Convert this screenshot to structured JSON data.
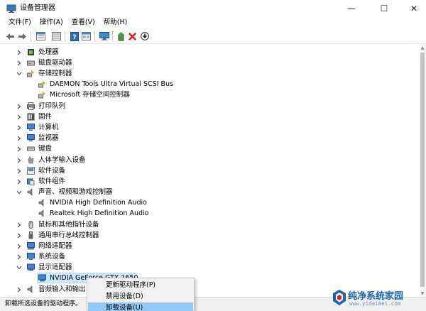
{
  "window": {
    "title": "设备管理器",
    "minimize": "—",
    "maximize": "☐",
    "close": "✕"
  },
  "menu": [
    "文件(F)",
    "操作(A)",
    "查看(V)",
    "帮助(H)"
  ],
  "toolbar_icons": [
    "back-icon",
    "forward-icon",
    "properties-icon",
    "device-list-icon",
    "help-icon",
    "grid-icon",
    "monitor-icon",
    "update-driver-icon",
    "uninstall-icon",
    "download-icon"
  ],
  "tree": [
    {
      "label": "处理器",
      "level": 0,
      "expanded": false,
      "icon": "cpu-icon"
    },
    {
      "label": "磁盘驱动器",
      "level": 0,
      "expanded": false,
      "icon": "disk-icon"
    },
    {
      "label": "存储控制器",
      "level": 0,
      "expanded": true,
      "icon": "storage-controller-icon"
    },
    {
      "label": "DAEMON Tools Ultra Virtual SCSI Bus",
      "level": 1,
      "icon": "storage-controller-icon"
    },
    {
      "label": "Microsoft 存储空间控制器",
      "level": 1,
      "icon": "storage-controller-icon"
    },
    {
      "label": "打印队列",
      "level": 0,
      "expanded": false,
      "icon": "printer-icon"
    },
    {
      "label": "固件",
      "level": 0,
      "expanded": false,
      "icon": "firmware-icon"
    },
    {
      "label": "计算机",
      "level": 0,
      "expanded": false,
      "icon": "computer-icon"
    },
    {
      "label": "监视器",
      "level": 0,
      "expanded": false,
      "icon": "monitor-icon"
    },
    {
      "label": "键盘",
      "level": 0,
      "expanded": false,
      "icon": "keyboard-icon"
    },
    {
      "label": "人体学输入设备",
      "level": 0,
      "expanded": false,
      "icon": "hid-icon"
    },
    {
      "label": "软件设备",
      "level": 0,
      "expanded": false,
      "icon": "software-device-icon"
    },
    {
      "label": "软件组件",
      "level": 0,
      "expanded": false,
      "icon": "software-component-icon"
    },
    {
      "label": "声音、视频和游戏控制器",
      "level": 0,
      "expanded": true,
      "icon": "speaker-icon"
    },
    {
      "label": "NVIDIA High Definition Audio",
      "level": 1,
      "icon": "speaker-icon"
    },
    {
      "label": "Realtek High Definition Audio",
      "level": 1,
      "icon": "speaker-icon"
    },
    {
      "label": "鼠标和其他指针设备",
      "level": 0,
      "expanded": false,
      "icon": "mouse-icon"
    },
    {
      "label": "通用串行总线控制器",
      "level": 0,
      "expanded": false,
      "icon": "usb-icon"
    },
    {
      "label": "网络适配器",
      "level": 0,
      "expanded": false,
      "icon": "network-icon"
    },
    {
      "label": "系统设备",
      "level": 0,
      "expanded": false,
      "icon": "system-device-icon"
    },
    {
      "label": "显示适配器",
      "level": 0,
      "expanded": true,
      "icon": "display-adapter-icon"
    },
    {
      "label": "NVIDIA GeForce GTX 1650",
      "level": 1,
      "icon": "display-adapter-icon",
      "selected": true
    },
    {
      "label": "音频输入和输出",
      "level": 0,
      "expanded": false,
      "icon": "audio-io-icon"
    }
  ],
  "context_menu": [
    {
      "label": "更新驱动程序(P)",
      "highlighted": false
    },
    {
      "label": "禁用设备(D)",
      "highlighted": false
    },
    {
      "label": "卸载设备(U)",
      "highlighted": true
    }
  ],
  "status_text": "卸载所选设备的驱动程序。",
  "watermark": {
    "text": "纯净系统家园",
    "url": "www.yidaimei.com"
  },
  "colors": {
    "selection": "#cce8ff",
    "menu_highlight": "#91c9f7",
    "status_bar": "#f0f0f0",
    "watermark": "#1b65b5"
  }
}
